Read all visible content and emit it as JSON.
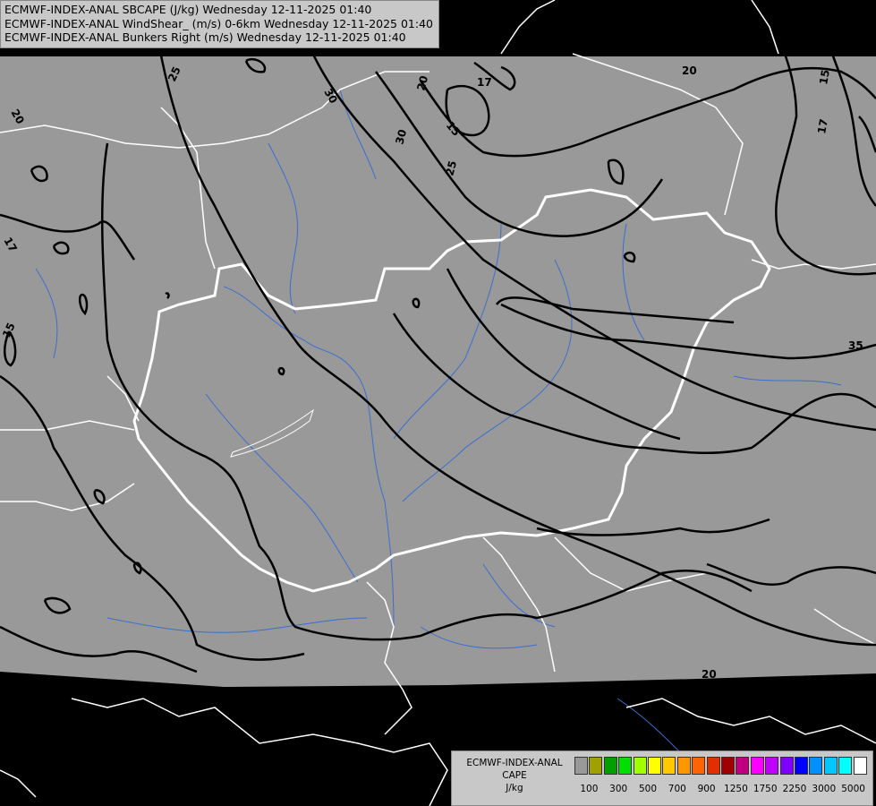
{
  "titles": [
    "ECMWF-INDEX-ANAL SBCAPE (J/kg) Wednesday 12-11-2025 01:40",
    "ECMWF-INDEX-ANAL WindShear_ (m/s) 0-6km Wednesday 12-11-2025 01:40",
    "ECMWF-INDEX-ANAL Bunkers Right (m/s) Wednesday 12-11-2025 01:40"
  ],
  "contour_labels": [
    {
      "text": "25"
    },
    {
      "text": "20"
    },
    {
      "text": "30"
    },
    {
      "text": "20"
    },
    {
      "text": "17"
    },
    {
      "text": "15"
    },
    {
      "text": "30"
    },
    {
      "text": "25"
    },
    {
      "text": "20"
    },
    {
      "text": "15"
    },
    {
      "text": "17"
    },
    {
      "text": "17"
    },
    {
      "text": "15"
    },
    {
      "text": "35"
    },
    {
      "text": "20"
    }
  ],
  "legend": {
    "title_lines": [
      "ECMWF-INDEX-ANAL",
      "CAPE",
      "J/kg"
    ],
    "colors": [
      "#999999",
      "#a0a000",
      "#00a000",
      "#00e000",
      "#a0ff00",
      "#ffff00",
      "#ffc800",
      "#ff9600",
      "#ff6400",
      "#e03000",
      "#a00000",
      "#c00080",
      "#ff00ff",
      "#c000ff",
      "#7f00ff",
      "#0000ff",
      "#0090ff",
      "#00c8ff",
      "#00ffff",
      "#ffffff"
    ],
    "ticks": [
      "100",
      "300",
      "500",
      "700",
      "900",
      "1250",
      "1750",
      "2250",
      "3000",
      "5000"
    ]
  },
  "colors": {
    "domain_fill": "#999999",
    "outside": "#000000",
    "contour": "#000000",
    "borders": "#ffffff",
    "rivers": "#3a6fd0"
  }
}
